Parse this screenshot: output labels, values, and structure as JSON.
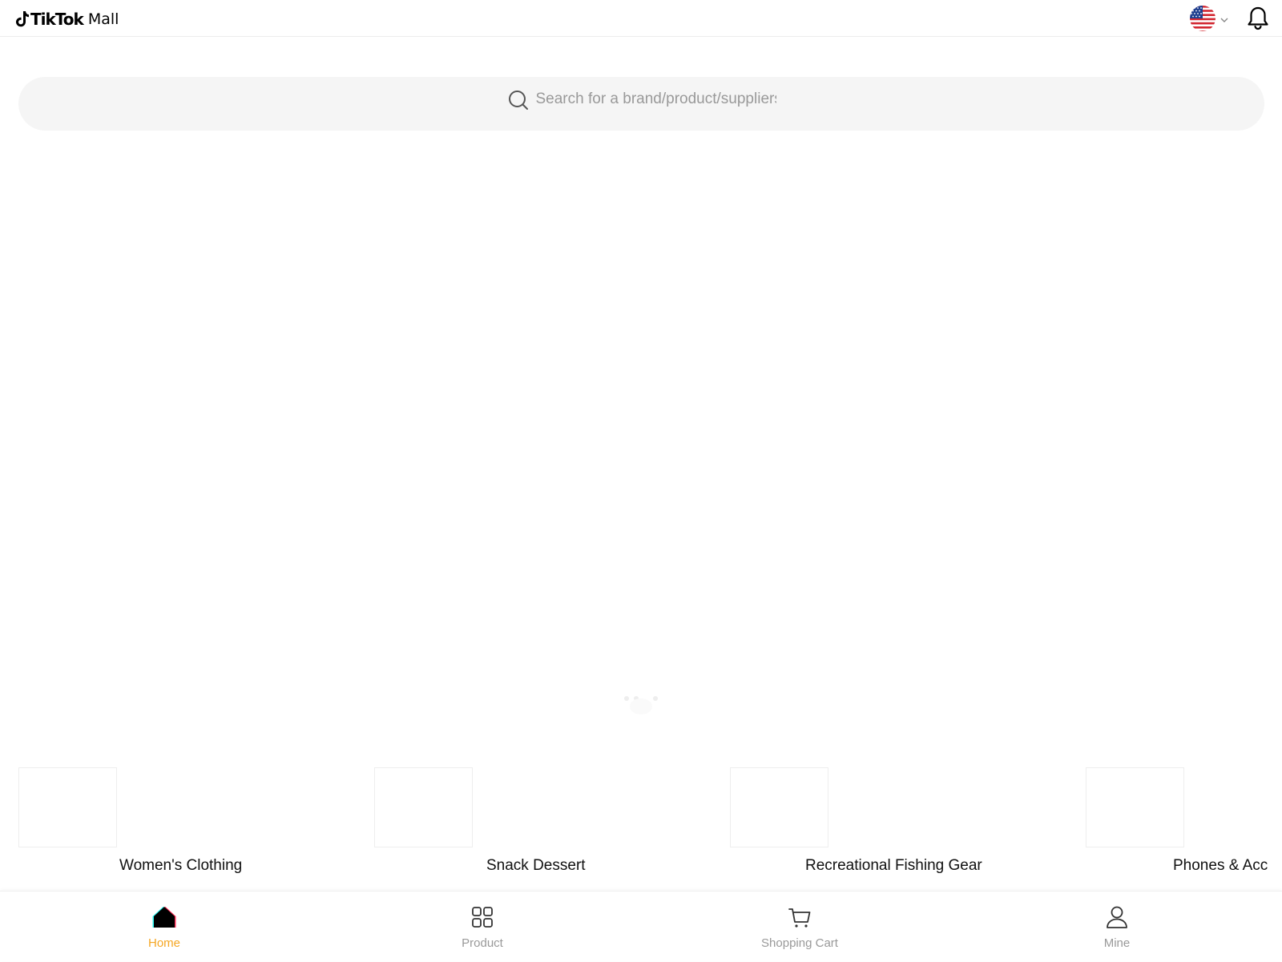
{
  "header": {
    "brand": "TikTok",
    "brand_suffix": "Mall",
    "language_flag": "us-flag-icon",
    "notification_icon": "bell-icon"
  },
  "search": {
    "placeholder": "Search for a brand/product/suppliers",
    "value": ""
  },
  "categories": [
    {
      "label": "Women's Clothing"
    },
    {
      "label": "Snack Dessert"
    },
    {
      "label": "Recreational Fishing Gear"
    },
    {
      "label": "Phones & Acc"
    }
  ],
  "tabbar": {
    "items": [
      {
        "label": "Home",
        "icon": "home-icon",
        "active": true
      },
      {
        "label": "Product",
        "icon": "grid-icon",
        "active": false
      },
      {
        "label": "Shopping Cart",
        "icon": "cart-icon",
        "active": false
      },
      {
        "label": "Mine",
        "icon": "user-icon",
        "active": false
      }
    ]
  },
  "colors": {
    "accent": "#f5a623",
    "search_bg": "#f5f5f5",
    "inactive_tab": "#999999"
  }
}
